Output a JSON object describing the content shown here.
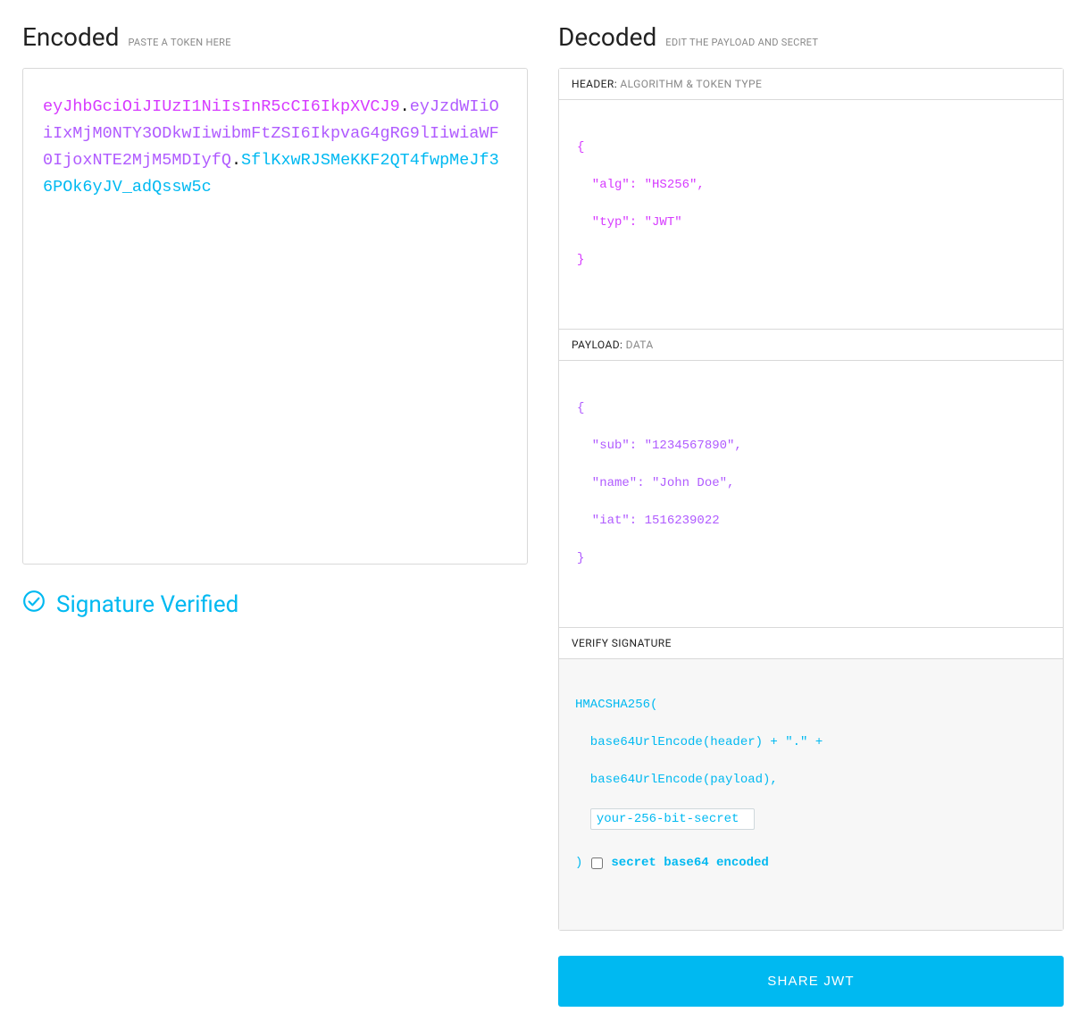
{
  "encoded": {
    "title": "Encoded",
    "subtitle": "PASTE A TOKEN HERE",
    "token": {
      "header": "eyJhbGciOiJIUzI1NiIsInR5cCI6IkpXVCJ9",
      "payload": "eyJzdWIiOiIxMjM0NTY3ODkwIiwibmFtZSI6IkpvaG4gRG9lIiwiaWF0IjoxNTE2MjM5MDIyfQ",
      "signature": "SflKxwRJSMeKKF2QT4fwpMeJf36POk6yJV_adQssw5c"
    }
  },
  "decoded": {
    "title": "Decoded",
    "subtitle": "EDIT THE PAYLOAD AND SECRET",
    "header_section": {
      "label": "HEADER:",
      "sublabel": "ALGORITHM & TOKEN TYPE",
      "lines": [
        "{",
        "  \"alg\": \"HS256\",",
        "  \"typ\": \"JWT\"",
        "}"
      ]
    },
    "payload_section": {
      "label": "PAYLOAD:",
      "sublabel": "DATA",
      "lines": [
        "{",
        "  \"sub\": \"1234567890\",",
        "  \"name\": \"John Doe\",",
        "  \"iat\": 1516239022",
        "}"
      ]
    },
    "signature_section": {
      "label": "VERIFY SIGNATURE",
      "line1": "HMACSHA256(",
      "line2": "  base64UrlEncode(header) + \".\" +",
      "line3": "  base64UrlEncode(payload),",
      "secret_value": "your-256-bit-secret",
      "close_paren": ")",
      "checkbox_label": "secret base64 encoded",
      "checkbox_checked": false
    }
  },
  "verify": {
    "text": "Signature Verified"
  },
  "share": {
    "label": "SHARE JWT"
  }
}
